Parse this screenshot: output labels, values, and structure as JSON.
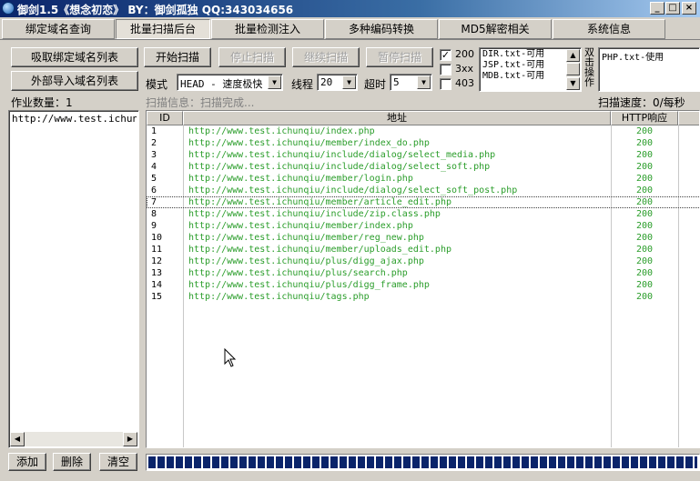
{
  "window": {
    "title": "御剑1.5《想念初恋》 BY：御剑孤独 QQ:343034656",
    "minimize": "_",
    "maximize": "□",
    "close": "×"
  },
  "tabs": [
    {
      "label": "绑定域名查询",
      "active": false
    },
    {
      "label": "批量扫描后台",
      "active": true
    },
    {
      "label": "批量检测注入",
      "active": false
    },
    {
      "label": "多种编码转换",
      "active": false
    },
    {
      "label": "MD5解密相关",
      "active": false
    },
    {
      "label": "系统信息",
      "active": false
    }
  ],
  "left": {
    "import_bound": "吸取绑定域名列表",
    "import_external": "外部导入域名列表",
    "job_count_label": "作业数量：1",
    "domains": [
      "http://www.test.ichunqiu"
    ],
    "add": "添加",
    "delete": "删除",
    "clear": "清空"
  },
  "controls": {
    "start_scan": "开始扫描",
    "stop_scan": "停止扫描",
    "continue_scan": "继续扫描",
    "pause_scan": "暂停扫描",
    "mode_label": "模式",
    "mode_value": "HEAD - 速度极快",
    "threads_label": "线程",
    "threads_value": "20",
    "timeout_label": "超时",
    "timeout_value": "5",
    "status_200": "200",
    "status_3xx": "3xx",
    "status_403": "403",
    "status_200_checked": true,
    "status_3xx_checked": false,
    "status_403_checked": false,
    "dicts": [
      "DIR.txt-可用",
      "JSP.txt-可用",
      "MDB.txt-可用"
    ],
    "dbl_click_label": "双击操作",
    "php_dict": "PHP.txt-使用",
    "scan_info": "扫描信息：扫描完成...",
    "scan_speed": "扫描速度：0/每秒"
  },
  "results": {
    "col_id": "ID",
    "col_url": "地址",
    "col_code": "HTTP响应",
    "rows": [
      {
        "id": "1",
        "url": "http://www.test.ichunqiu/index.php",
        "code": "200"
      },
      {
        "id": "2",
        "url": "http://www.test.ichunqiu/member/index_do.php",
        "code": "200"
      },
      {
        "id": "3",
        "url": "http://www.test.ichunqiu/include/dialog/select_media.php",
        "code": "200"
      },
      {
        "id": "4",
        "url": "http://www.test.ichunqiu/include/dialog/select_soft.php",
        "code": "200"
      },
      {
        "id": "5",
        "url": "http://www.test.ichunqiu/member/login.php",
        "code": "200"
      },
      {
        "id": "6",
        "url": "http://www.test.ichunqiu/include/dialog/select_soft_post.php",
        "code": "200"
      },
      {
        "id": "7",
        "url": "http://www.test.ichunqiu/member/article_edit.php",
        "code": "200"
      },
      {
        "id": "8",
        "url": "http://www.test.ichunqiu/include/zip.class.php",
        "code": "200"
      },
      {
        "id": "9",
        "url": "http://www.test.ichunqiu/member/index.php",
        "code": "200"
      },
      {
        "id": "10",
        "url": "http://www.test.ichunqiu/member/reg_new.php",
        "code": "200"
      },
      {
        "id": "11",
        "url": "http://www.test.ichunqiu/member/uploads_edit.php",
        "code": "200"
      },
      {
        "id": "12",
        "url": "http://www.test.ichunqiu/plus/digg_ajax.php",
        "code": "200"
      },
      {
        "id": "13",
        "url": "http://www.test.ichunqiu/plus/search.php",
        "code": "200"
      },
      {
        "id": "14",
        "url": "http://www.test.ichunqiu/plus/digg_frame.php",
        "code": "200"
      },
      {
        "id": "15",
        "url": "http://www.test.ichunqiu/tags.php",
        "code": "200"
      }
    ]
  },
  "progress": {
    "percent": 100
  },
  "colors": {
    "result_text": "#2a9d2a",
    "title_bar": "#0a246a",
    "progress": "#0a246a"
  }
}
